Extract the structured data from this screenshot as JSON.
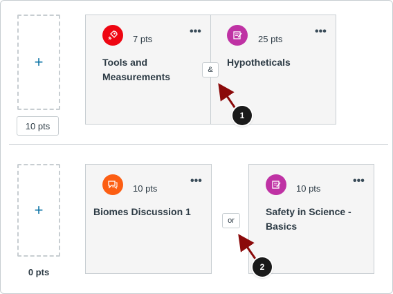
{
  "colors": {
    "accent": "#0770a3",
    "badge_red": "#ee0612",
    "badge_orange": "#fc5e13",
    "badge_magenta": "#bf32a4",
    "arrow": "#8b0a0a"
  },
  "row1": {
    "points_button": "10 pts",
    "add_icon": "plus-icon",
    "op_label": "&",
    "items": [
      {
        "icon": "rocket-icon",
        "pts": "7 pts",
        "title": "Tools and Measurements",
        "menu": "•••"
      },
      {
        "icon": "quiz-icon",
        "pts": "25 pts",
        "title": "Hypotheticals",
        "menu": "•••"
      }
    ]
  },
  "row2": {
    "points_text": "0 pts",
    "add_icon": "plus-icon",
    "op_label": "or",
    "items": [
      {
        "icon": "discussion-icon",
        "pts": "10 pts",
        "title": "Biomes Discussion 1",
        "menu": "•••"
      },
      {
        "icon": "quiz-icon",
        "pts": "10 pts",
        "title": "Safety in Science - Basics",
        "menu": "•••"
      }
    ]
  },
  "callouts": [
    "1",
    "2"
  ]
}
